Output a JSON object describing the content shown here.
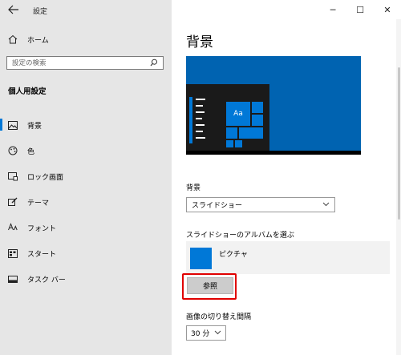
{
  "window": {
    "title": "設定",
    "controls": {
      "minimize": "─",
      "maximize": "☐",
      "close": "✕"
    }
  },
  "left": {
    "home_label": "ホーム",
    "search_placeholder": "設定の検索",
    "section_title": "個人用設定",
    "nav": [
      {
        "label": "背景",
        "icon": "picture-icon",
        "active": true
      },
      {
        "label": "色",
        "icon": "palette-icon"
      },
      {
        "label": "ロック画面",
        "icon": "lock-screen-icon"
      },
      {
        "label": "テーマ",
        "icon": "theme-brush-icon"
      },
      {
        "label": "フォント",
        "icon": "font-icon"
      },
      {
        "label": "スタート",
        "icon": "start-icon"
      },
      {
        "label": "タスク バー",
        "icon": "taskbar-icon"
      }
    ]
  },
  "main": {
    "title": "背景",
    "preview": {
      "tile_text": "Aa",
      "accent": "#0078d7",
      "background": "#0063b1"
    },
    "background_label": "背景",
    "background_value": "スライドショー",
    "album_label": "スライドショーのアルバムを選ぶ",
    "album_name": "ピクチャ",
    "browse_label": "参照",
    "interval_label": "画像の切り替え間隔",
    "interval_value": "30 分"
  },
  "colors": {
    "accent": "#0078d7",
    "highlight": "#e00000",
    "sidebar_bg": "#e6e6e6"
  }
}
